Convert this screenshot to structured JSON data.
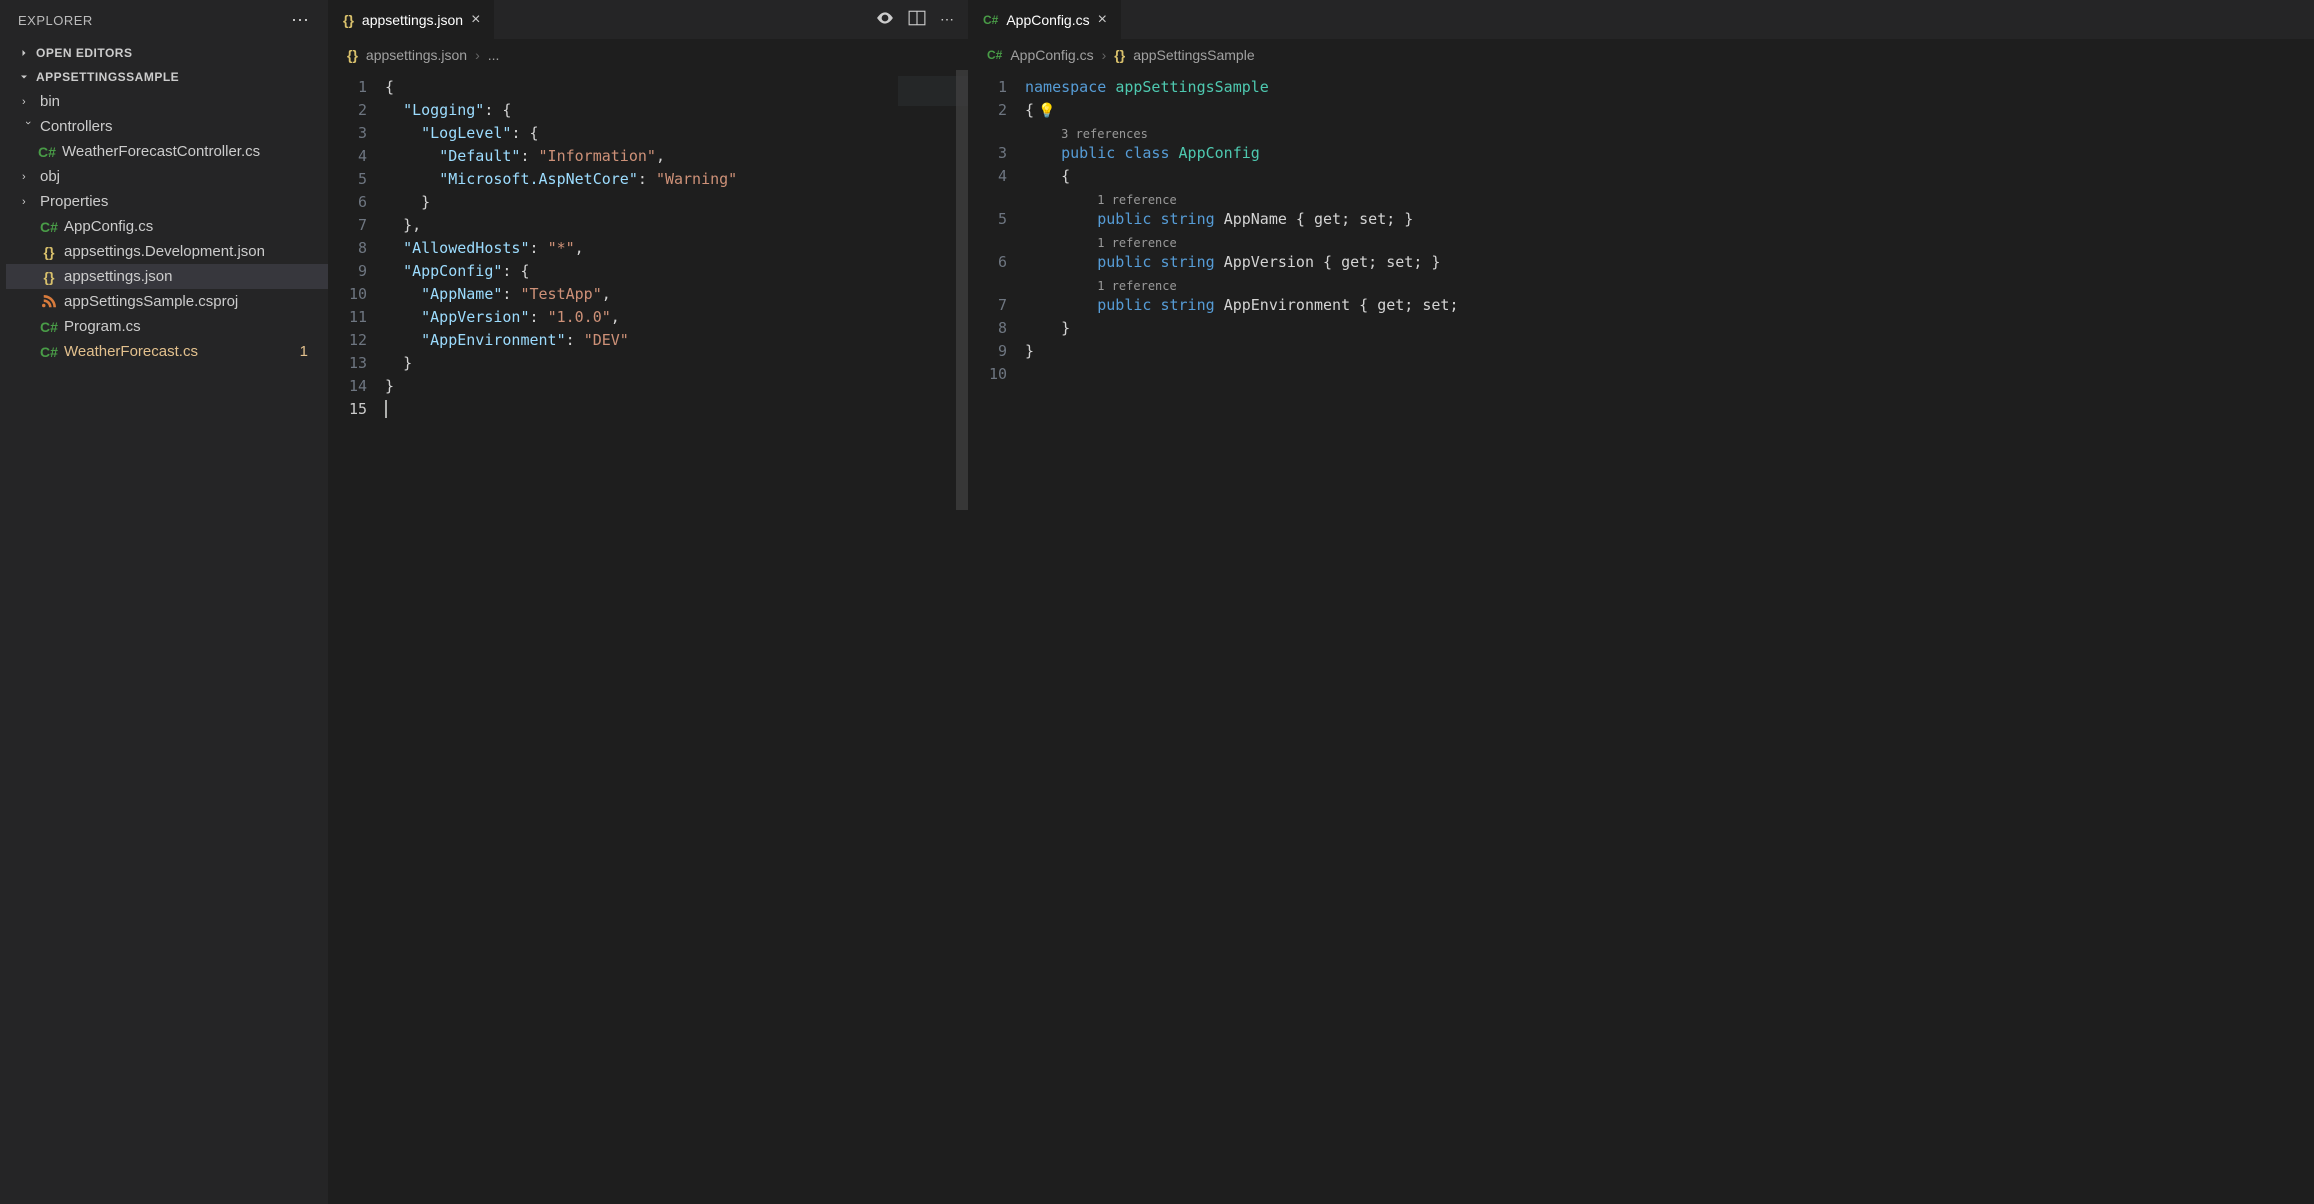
{
  "sidebar": {
    "title": "EXPLORER",
    "openEditors": "OPEN EDITORS",
    "project": "APPSETTINGSSAMPLE",
    "tree": {
      "bin": "bin",
      "controllers": "Controllers",
      "weatherForecastController": "WeatherForecastController.cs",
      "obj": "obj",
      "properties": "Properties",
      "appConfig": "AppConfig.cs",
      "appsettingsDev": "appsettings.Development.json",
      "appsettingsJson": "appsettings.json",
      "csproj": "appSettingsSample.csproj",
      "program": "Program.cs",
      "weatherForecast": "WeatherForecast.cs",
      "weatherForecastBadge": "1"
    }
  },
  "leftEditor": {
    "tab": "appsettings.json",
    "breadcrumb": "appsettings.json",
    "breadcrumbMore": "...",
    "json": {
      "Logging": {
        "LogLevel": {
          "Default": "Information",
          "Microsoft.AspNetCore": "Warning"
        }
      },
      "AllowedHosts": "*",
      "AppConfig": {
        "AppName": "TestApp",
        "AppVersion": "1.0.0",
        "AppEnvironment": "DEV"
      }
    },
    "lineNumbers": [
      "1",
      "2",
      "3",
      "4",
      "5",
      "6",
      "7",
      "8",
      "9",
      "10",
      "11",
      "12",
      "13",
      "14",
      "15"
    ]
  },
  "rightEditor": {
    "tab": "AppConfig.cs",
    "breadcrumbFile": "AppConfig.cs",
    "breadcrumbNamespace": "appSettingsSample",
    "code": {
      "namespaceKw": "namespace",
      "namespaceName": "appSettingsSample",
      "refs3": "3 references",
      "publicKw": "public",
      "classKw": "class",
      "className": "AppConfig",
      "stringKw": "string",
      "ref1": "1 reference",
      "prop1": "AppName",
      "prop2": "AppVersion",
      "prop3": "AppEnvironment",
      "getset": "{ get; set; }",
      "getsetPartial": "{ get; set;",
      "braceOpen": "{",
      "braceClose": "}"
    },
    "lineNumbers": [
      "1",
      "2",
      "3",
      "4",
      "5",
      "6",
      "7",
      "8",
      "9",
      "10"
    ]
  }
}
